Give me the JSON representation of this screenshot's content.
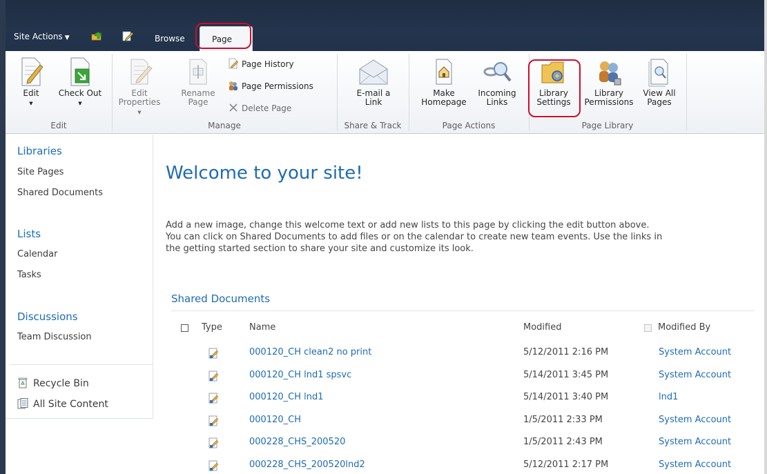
{
  "top_bar": {
    "site_actions": "Site Actions",
    "tabs": [
      {
        "label": "Browse"
      },
      {
        "label": "Page"
      }
    ]
  },
  "ribbon": {
    "groups": {
      "edit": "Edit",
      "manage": "Manage",
      "share_track": "Share & Track",
      "page_actions": "Page Actions",
      "page_library": "Page Library"
    },
    "edit_label": "Edit",
    "check_out_label": "Check Out",
    "edit_properties": [
      "Edit",
      "Properties"
    ],
    "rename_page": [
      "Rename",
      "Page"
    ],
    "page_history": "Page History",
    "page_permissions": "Page Permissions",
    "delete_page": "Delete Page",
    "email_link": [
      "E-mail a",
      "Link"
    ],
    "make_homepage": [
      "Make",
      "Homepage"
    ],
    "incoming_links": [
      "Incoming",
      "Links"
    ],
    "library_settings": [
      "Library",
      "Settings"
    ],
    "library_permissions": [
      "Library",
      "Permissions"
    ],
    "view_all_pages": [
      "View All",
      "Pages"
    ]
  },
  "leftnav": {
    "libraries": "Libraries",
    "site_pages": "Site Pages",
    "shared_documents": "Shared Documents",
    "lists": "Lists",
    "calendar": "Calendar",
    "tasks": "Tasks",
    "discussions": "Discussions",
    "team_discussion": "Team Discussion",
    "recycle_bin": "Recycle Bin",
    "all_site_content": "All Site Content"
  },
  "main": {
    "title": "Welcome to your site!",
    "welcome_lines": [
      "Add a new image, change this welcome text or add new lists to this page by clicking the edit button above.",
      "You can click on Shared Documents to add files or on the calendar to create new team events. Use the links in",
      "the getting started section to share your site and customize its look."
    ],
    "section_title": "Shared Documents",
    "columns": {
      "type": "Type",
      "name": "Name",
      "modified": "Modified",
      "modified_by": "Modified By"
    },
    "rows": [
      {
        "name": "000120_CH clean2 no print",
        "modified": "5/12/2011 2:16 PM",
        "by": "System Account"
      },
      {
        "name": "000120_CH lnd1 spsvc",
        "modified": "5/14/2011 3:45 PM",
        "by": "System Account"
      },
      {
        "name": "000120_CH lnd1",
        "modified": "5/14/2011 3:40 PM",
        "by": "lnd1"
      },
      {
        "name": "000120_CH",
        "modified": "1/5/2011 2:33 PM",
        "by": "System Account"
      },
      {
        "name": "000228_CHS_200520",
        "modified": "1/5/2011 2:43 PM",
        "by": "System Account"
      },
      {
        "name": "000228_CHS_200520lnd2",
        "modified": "5/12/2011 2:17 PM",
        "by": "System Account"
      }
    ]
  }
}
